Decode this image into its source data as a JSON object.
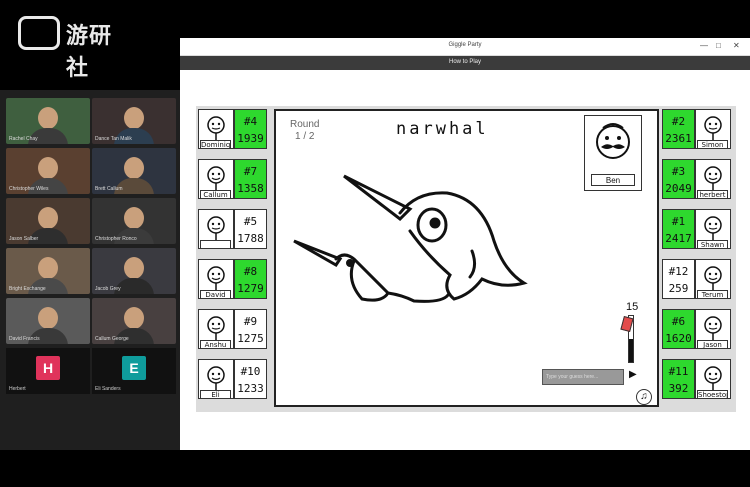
{
  "logo": {
    "text": "游研社"
  },
  "call": {
    "participants": [
      {
        "name": "Rachel Chay"
      },
      {
        "name": "Dance Tan Malik"
      },
      {
        "name": "Christopher Wiles"
      },
      {
        "name": "Brett Callum"
      },
      {
        "name": "Jason Salber"
      },
      {
        "name": "Christopher Ronco"
      },
      {
        "name": "Bright Exchange"
      },
      {
        "name": "Jacob Grey"
      },
      {
        "name": "David Francis"
      },
      {
        "name": "Callum George"
      }
    ],
    "letter_tiles": [
      {
        "letter": "H",
        "name": "Herbert",
        "color": "#e0335b"
      },
      {
        "letter": "E",
        "name": "Eli Sanders",
        "color": "#0f9c9c"
      }
    ]
  },
  "window": {
    "title": "Giggle Party",
    "menu": "How to Play",
    "controls": [
      "—",
      "□",
      "✕"
    ]
  },
  "game": {
    "round_label": "Round",
    "round_value": "1 / 2",
    "word": "narwhal",
    "drawer": "Ben",
    "timer": 15,
    "guess_placeholder": "Type your guess here...",
    "send_icon": "play-arrow-icon",
    "music_icon": "music-note-icon",
    "left_players": [
      {
        "rank": "#4",
        "score": "1939",
        "name": "Dominique",
        "highlight": true
      },
      {
        "rank": "#7",
        "score": "1358",
        "name": "Callum",
        "highlight": true
      },
      {
        "rank": "#5",
        "score": "1788",
        "name": "",
        "highlight": false
      },
      {
        "rank": "#8",
        "score": "1279",
        "name": "David",
        "highlight": true
      },
      {
        "rank": "#9",
        "score": "1275",
        "name": "Anshu",
        "highlight": false
      },
      {
        "rank": "#10",
        "score": "1233",
        "name": "Eli",
        "highlight": false
      }
    ],
    "right_players": [
      {
        "rank": "#2",
        "score": "2361",
        "name": "Simon",
        "highlight": true
      },
      {
        "rank": "#3",
        "score": "2049",
        "name": "herbert",
        "highlight": true
      },
      {
        "rank": "#1",
        "score": "2417",
        "name": "Shawn",
        "highlight": true
      },
      {
        "rank": "#12",
        "score": "259",
        "name": "Terum",
        "highlight": false
      },
      {
        "rank": "#6",
        "score": "1620",
        "name": "Jason",
        "highlight": true
      },
      {
        "rank": "#11",
        "score": "392",
        "name": "Shoestopper",
        "highlight": true
      }
    ]
  }
}
